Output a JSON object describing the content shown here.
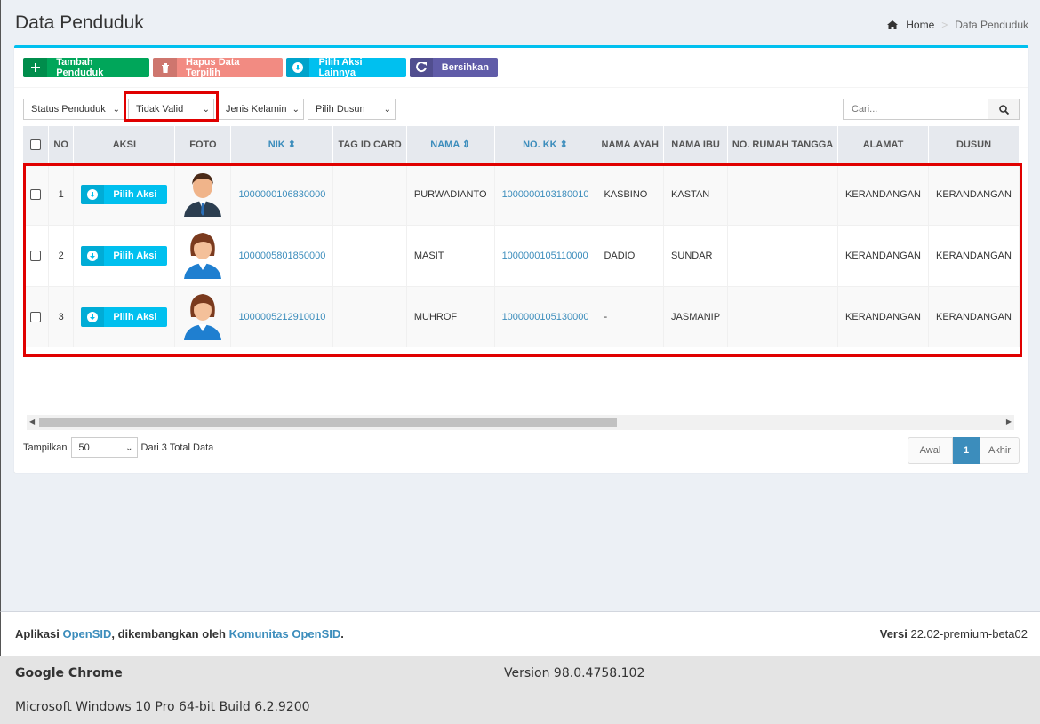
{
  "header": {
    "title": "Data Penduduk"
  },
  "breadcrumb": {
    "home": "Home",
    "current": "Data Penduduk"
  },
  "toolbar": {
    "add_label": "Tambah Penduduk",
    "delete_label": "Hapus Data Terpilih",
    "actions_label": "Pilih Aksi Lainnya",
    "clear_label": "Bersihkan"
  },
  "filters": {
    "status": "Status Penduduk",
    "validity": "Tidak Valid",
    "gender": "Jenis Kelamin",
    "dusun": "Pilih Dusun"
  },
  "search": {
    "placeholder": "Cari..."
  },
  "table": {
    "columns": [
      "NO",
      "AKSI",
      "FOTO",
      "NIK",
      "TAG ID CARD",
      "NAMA",
      "NO. KK",
      "NAMA AYAH",
      "NAMA IBU",
      "NO. RUMAH TANGGA",
      "ALAMAT",
      "DUSUN"
    ],
    "rows": [
      {
        "no": "1",
        "action": "Pilih Aksi",
        "photo": "male-avatar",
        "nik": "1000000106830000",
        "tag": "",
        "nama": "PURWADIANTO",
        "no_kk": "1000000103180010",
        "ayah": "KASBINO",
        "ibu": "KASTAN",
        "rumah_tangga": "",
        "alamat": "KERANDANGAN",
        "dusun": "KERANDANGAN"
      },
      {
        "no": "2",
        "action": "Pilih Aksi",
        "photo": "female-avatar",
        "nik": "1000005801850000",
        "tag": "",
        "nama": "MASIT",
        "no_kk": "1000000105110000",
        "ayah": "DADIO",
        "ibu": "SUNDAR",
        "rumah_tangga": "",
        "alamat": "KERANDANGAN",
        "dusun": "KERANDANGAN"
      },
      {
        "no": "3",
        "action": "Pilih Aksi",
        "photo": "female-avatar",
        "nik": "1000005212910010",
        "tag": "",
        "nama": "MUHROF",
        "no_kk": "1000000105130000",
        "ayah": "-",
        "ibu": "JASMANIP",
        "rumah_tangga": "",
        "alamat": "KERANDANGAN",
        "dusun": "KERANDANGAN"
      }
    ]
  },
  "pager": {
    "show_label": "Tampilkan",
    "per_page": "50",
    "total_text": "Dari 3 Total Data",
    "first": "Awal",
    "current": "1",
    "last": "Akhir"
  },
  "footer": {
    "app_prefix": "Aplikasi ",
    "app_name": "OpenSID",
    "app_middle": ", dikembangkan oleh ",
    "community": "Komunitas OpenSID",
    "app_suffix": ".",
    "version_label": "Versi",
    "version_value": "22.02-premium-beta02"
  },
  "browser_info": {
    "app": "Google Chrome",
    "version": "Version 98.0.4758.102",
    "os": "Microsoft Windows 10 Pro 64-bit Build 6.2.9200"
  },
  "colors": {
    "accent": "#3c8dbc",
    "info": "#00c0ef",
    "success": "#00a65a",
    "danger_light": "#f28b82",
    "purple": "#605ca8",
    "highlight": "#e00000"
  }
}
